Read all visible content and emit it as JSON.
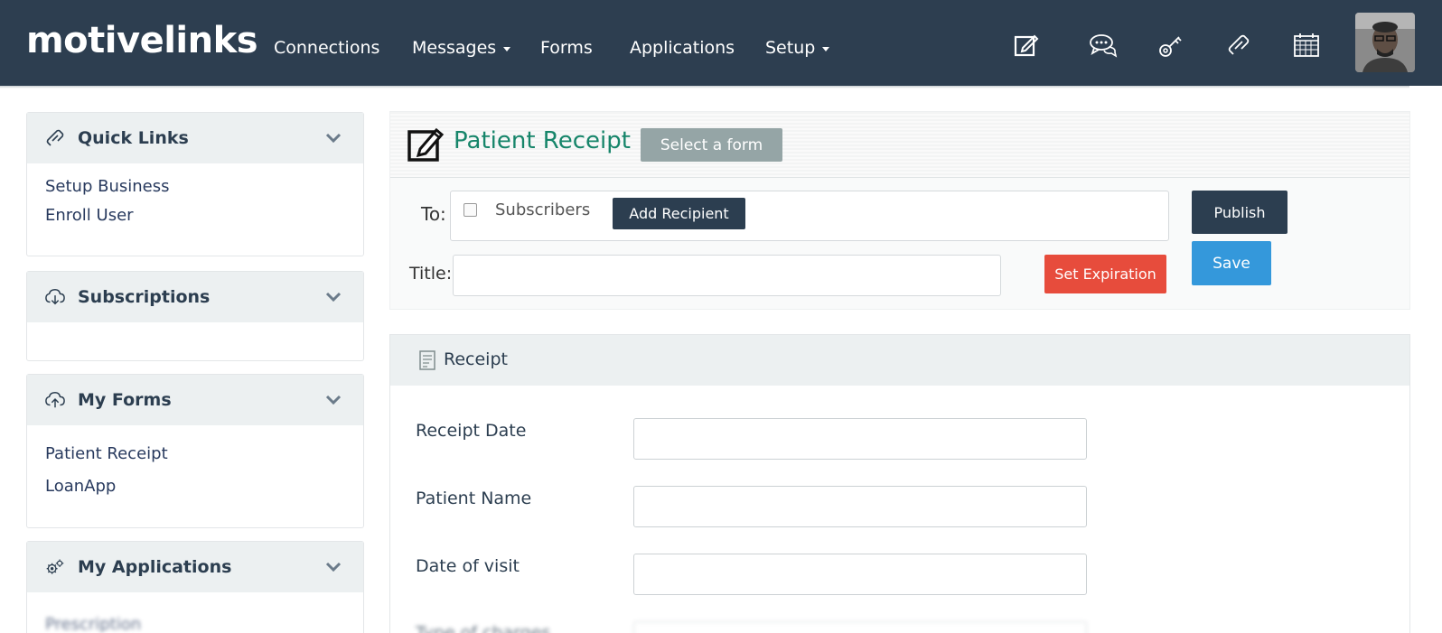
{
  "navbar": {
    "brand": "motivelinks",
    "items": [
      {
        "label": "Connections",
        "has_caret": false
      },
      {
        "label": "Messages",
        "has_caret": true
      },
      {
        "label": "Forms",
        "has_caret": false
      },
      {
        "label": "Applications",
        "has_caret": false
      },
      {
        "label": "Setup",
        "has_caret": true
      }
    ],
    "icons": [
      "compose-icon",
      "chat-icon",
      "key-icon",
      "link-icon",
      "calendar-icon"
    ],
    "background_color": "#2d3e50"
  },
  "sidebar": {
    "quick_links": {
      "title": "Quick Links",
      "items": [
        "Setup Business",
        "Enroll User"
      ]
    },
    "subscriptions": {
      "title": "Subscriptions",
      "items": []
    },
    "my_forms": {
      "title": "My Forms",
      "items": [
        "Patient Receipt",
        "LoanApp"
      ]
    },
    "my_applications": {
      "title": "My Applications",
      "items": [
        "Prescription"
      ]
    }
  },
  "form_header": {
    "title": "Patient Receipt",
    "select_form_label": "Select a form",
    "to_label": "To:",
    "subscribers_label": "Subscribers",
    "subscribers_checked": false,
    "add_recipient_label": "Add Recipient",
    "publish_label": "Publish",
    "save_label": "Save",
    "title_label": "Title:",
    "title_value": "",
    "set_expiration_label": "Set Expiration"
  },
  "receipt": {
    "section_title": "Receipt",
    "fields": [
      {
        "label": "Receipt Date",
        "value": ""
      },
      {
        "label": "Patient Name",
        "value": ""
      },
      {
        "label": "Date of visit",
        "value": ""
      },
      {
        "label": "Type of charges",
        "value": ""
      }
    ]
  },
  "colors": {
    "accent_green": "#16856a",
    "dark": "#2c3e50",
    "primary_blue": "#3498db",
    "danger_red": "#e74c3c",
    "muted_gray": "#95a5a6"
  }
}
